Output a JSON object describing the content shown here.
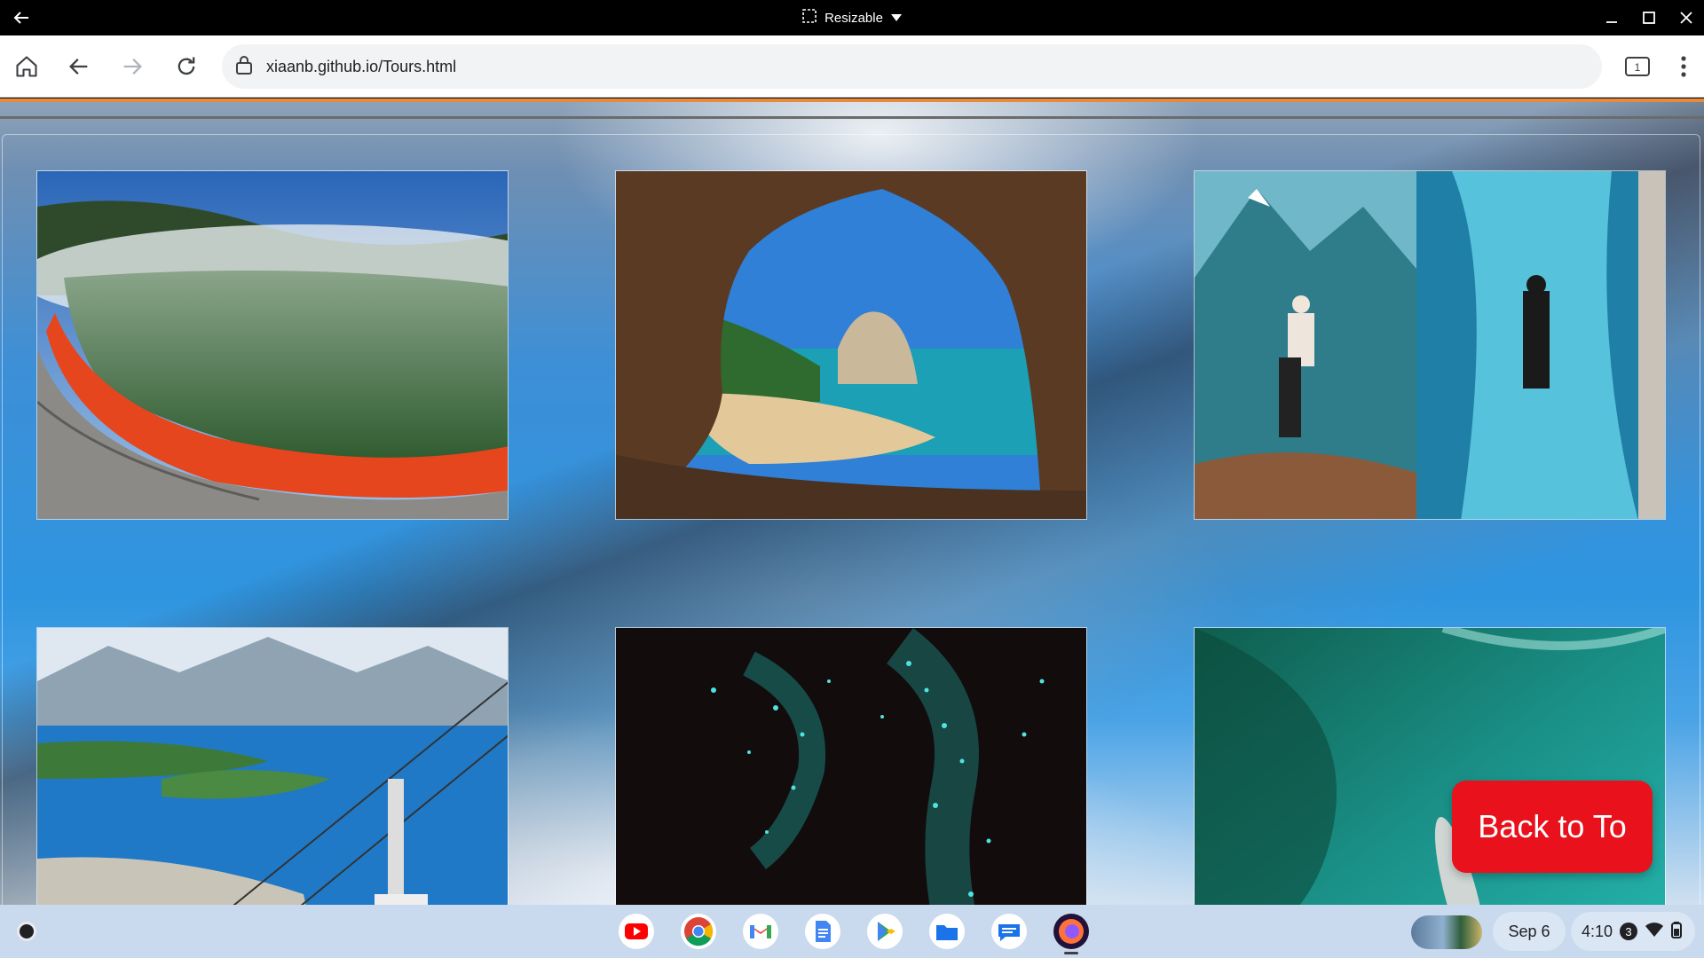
{
  "window": {
    "mode_label": "Resizable"
  },
  "browser": {
    "url": "xiaanb.github.io/Tours.html",
    "tab_count": "1"
  },
  "page": {
    "tiles": [
      {
        "scene": "geothermal-pool"
      },
      {
        "scene": "coastal-cave-arch"
      },
      {
        "scene": "alpine-glacier-collage"
      },
      {
        "scene": "lake-gondola-town"
      },
      {
        "scene": "glowworm-cave"
      },
      {
        "scene": "turquoise-sea-kayak"
      }
    ],
    "back_to_top_label": "Back to To"
  },
  "shelf": {
    "apps": [
      "youtube-icon",
      "chrome-icon",
      "gmail-icon",
      "docs-icon",
      "play-store-icon",
      "files-icon",
      "messages-icon",
      "firefox-icon"
    ],
    "date": "Sep 6",
    "time": "4:10",
    "notification_count": "3"
  },
  "colors": {
    "accent_red": "#e8111c",
    "shelf": "#c9d9ee"
  }
}
